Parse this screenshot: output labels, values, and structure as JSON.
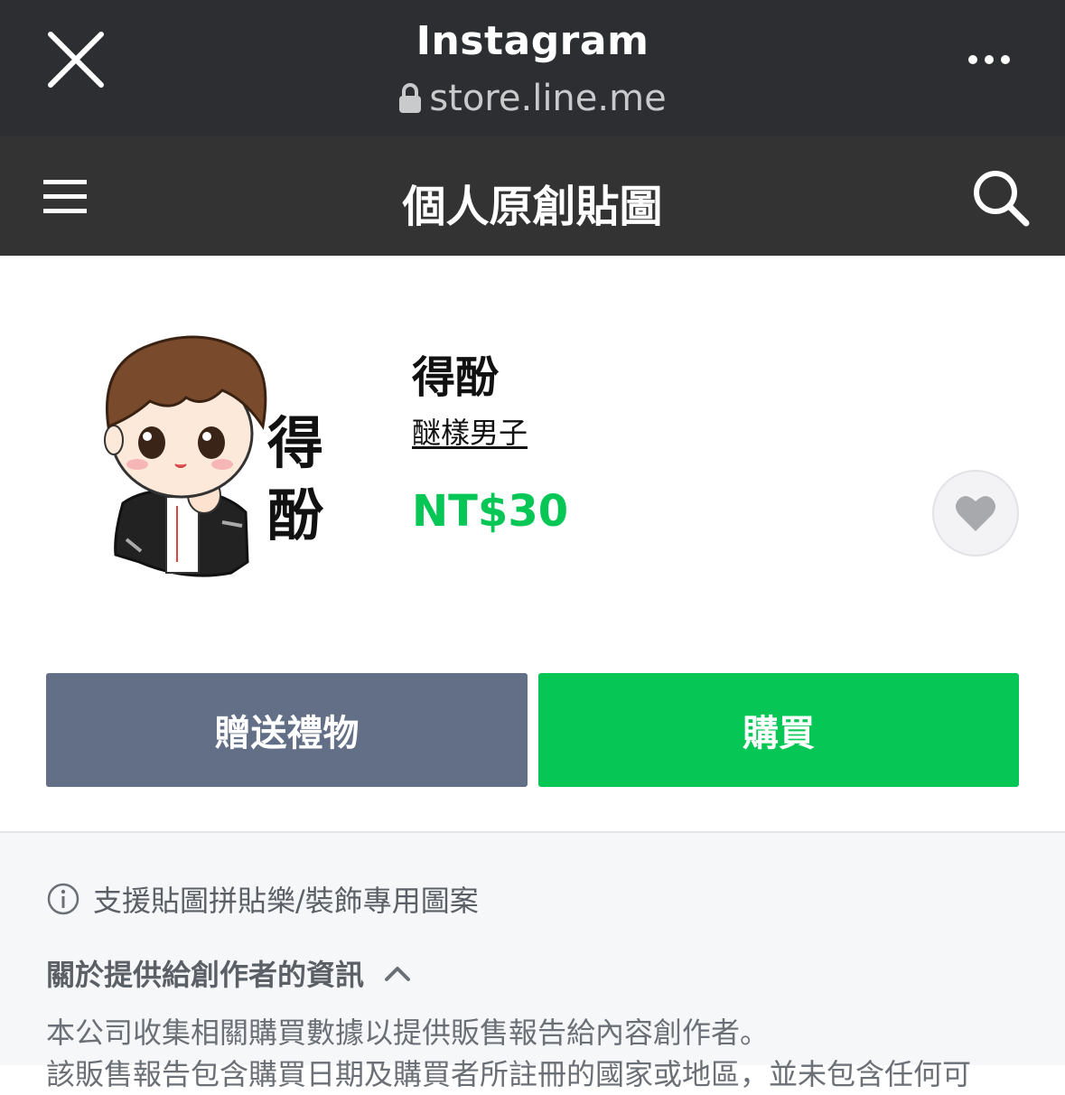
{
  "browser": {
    "title": "Instagram",
    "url": "store.line.me"
  },
  "header": {
    "title": "個人原創貼圖"
  },
  "sticker": {
    "name": "得酚",
    "author": "醚樣男子",
    "price": "NT$30"
  },
  "buttons": {
    "gift": "贈送禮物",
    "buy": "購買"
  },
  "info": {
    "support_text": "支援貼圖拼貼樂/裝飾專用圖案",
    "about_title": "關於提供給創作者的資訊",
    "description_line1": "本公司收集相關購買數據以提供販售報告給內容創作者。",
    "description_line2": "該販售報告包含購買日期及購買者所註冊的國家或地區，並未包含任何可"
  },
  "colors": {
    "browser_bar": "#2c2e31",
    "store_header": "#333333",
    "price_green": "#06c755",
    "gift_button": "#636f87",
    "buy_button": "#06c755"
  },
  "icons": [
    "close-icon",
    "more-icon",
    "lock-icon",
    "hamburger-icon",
    "search-icon",
    "heart-icon",
    "info-icon",
    "chevron-up-icon"
  ]
}
